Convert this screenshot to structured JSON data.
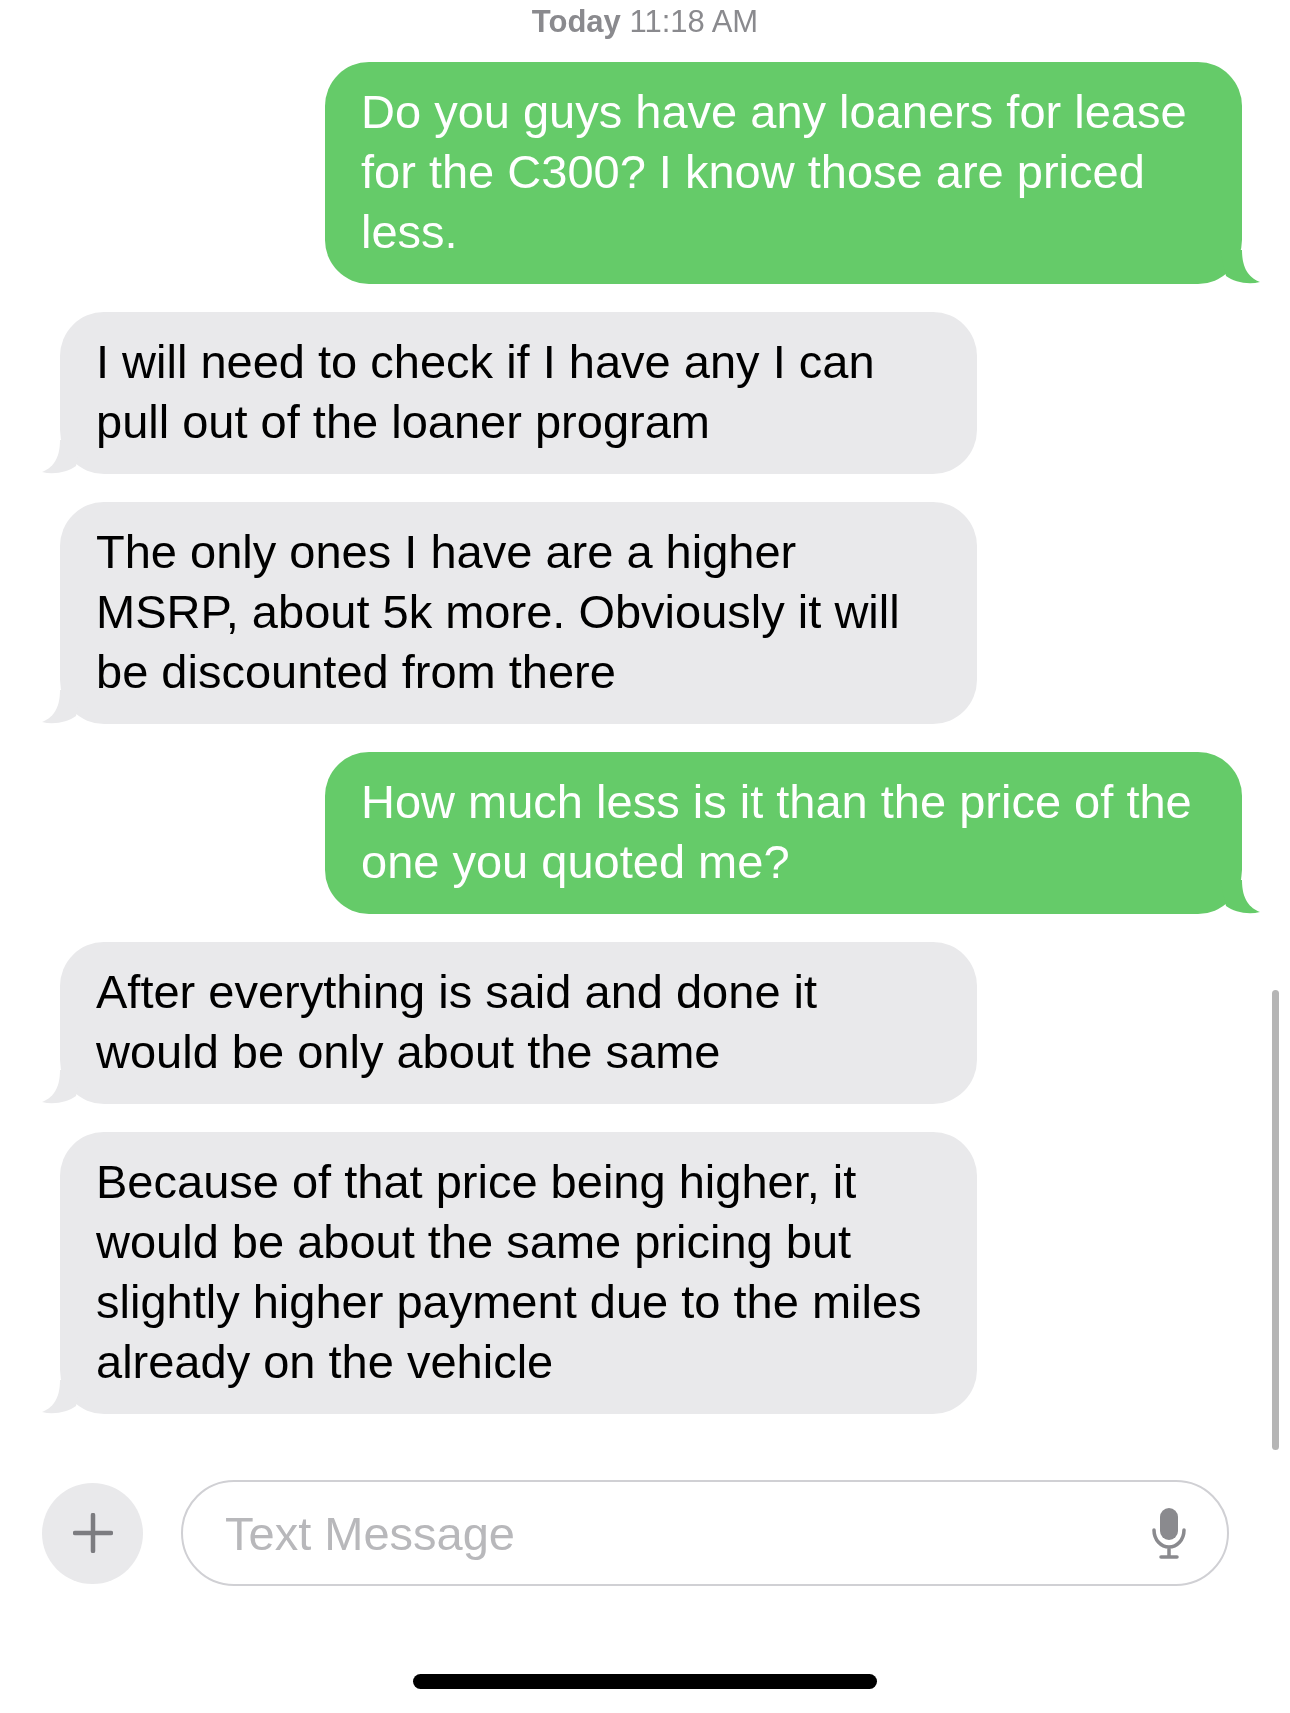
{
  "timestamp": {
    "day": "Today",
    "time": "11:18 AM"
  },
  "messages": [
    {
      "kind": "sent",
      "text": "Do you guys have any loaners for lease for the C300? I know those are priced less."
    },
    {
      "kind": "received",
      "text": "I will need to check if I have any I can pull out of the loaner program"
    },
    {
      "kind": "received",
      "text": "The only ones I have are a higher MSRP, about 5k more. Obviously it will be discounted from there"
    },
    {
      "kind": "sent",
      "text": "How much less is it than the price of the one you quoted me?"
    },
    {
      "kind": "received",
      "text": "After everything is said and done it would be only about the same"
    },
    {
      "kind": "received",
      "text": "Because of that price being higher, it would be about the same pricing but slightly higher payment due to the miles already on the vehicle"
    }
  ],
  "composer": {
    "placeholder": "Text Message"
  }
}
